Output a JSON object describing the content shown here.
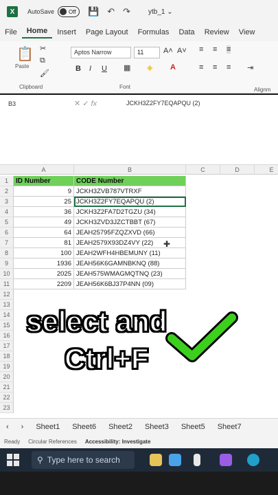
{
  "titlebar": {
    "autosave_label": "AutoSave",
    "autosave_state": "Off",
    "filename": "ytb_1 ⌄"
  },
  "menu": [
    "File",
    "Home",
    "Insert",
    "Page Layout",
    "Formulas",
    "Data",
    "Review",
    "View"
  ],
  "ribbon": {
    "paste_label": "Paste",
    "font_name": "Aptos Narrow",
    "font_size": "11",
    "clipboard_label": "Clipboard",
    "font_label": "Font",
    "alignment_label": "Alignm"
  },
  "formula_bar": {
    "name_box": "B3",
    "content": "JCKH3Z2FY7EQAPQU  (2)"
  },
  "columns": [
    "A",
    "B",
    "C",
    "D",
    "E"
  ],
  "table": {
    "headers": [
      "ID Number",
      "CODE Number"
    ],
    "rows": [
      {
        "id": "9",
        "code": "JCKH3ZVB787VTRXF"
      },
      {
        "id": "25",
        "code": "JCKH3Z2FY7EQAPQU  (2)"
      },
      {
        "id": "36",
        "code": "JCKH3Z2FA7D2TGZU  (34)"
      },
      {
        "id": "49",
        "code": "JCKH3ZVD3JZCTBBT  (67)"
      },
      {
        "id": "64",
        "code": "JEAH25795FZQZXVD  (66)"
      },
      {
        "id": "81",
        "code": "JEAH2579X93DZ4VY  (22)"
      },
      {
        "id": "100",
        "code": "JEAH2WFH4HBEMUNY  (11)"
      },
      {
        "id": "1936",
        "code": "JEAH56K6GAMNBKNQ  (88)"
      },
      {
        "id": "2025",
        "code": "JEAH575WMAGMQTNQ  (23)"
      },
      {
        "id": "2209",
        "code": "JEAH56K6BJ37P4NN     (09)"
      }
    ],
    "row_numbers": [
      "1",
      "2",
      "3",
      "4",
      "5",
      "6",
      "7",
      "8",
      "9",
      "10",
      "11",
      "12",
      "13",
      "14",
      "15",
      "16",
      "17",
      "18",
      "19",
      "20",
      "21",
      "22",
      "23"
    ]
  },
  "overlay": {
    "line1": "select and",
    "line2": "Ctrl+F",
    "check_color": "#3ccf1e"
  },
  "sheets": [
    "Sheet1",
    "Sheet6",
    "Sheet2",
    "Sheet3",
    "Sheet5",
    "Sheet7"
  ],
  "status": {
    "ready": "Ready",
    "circular": "Circular References",
    "accessibility": "Accessibility: Investigate"
  },
  "taskbar": {
    "search_placeholder": "Type here to search"
  }
}
